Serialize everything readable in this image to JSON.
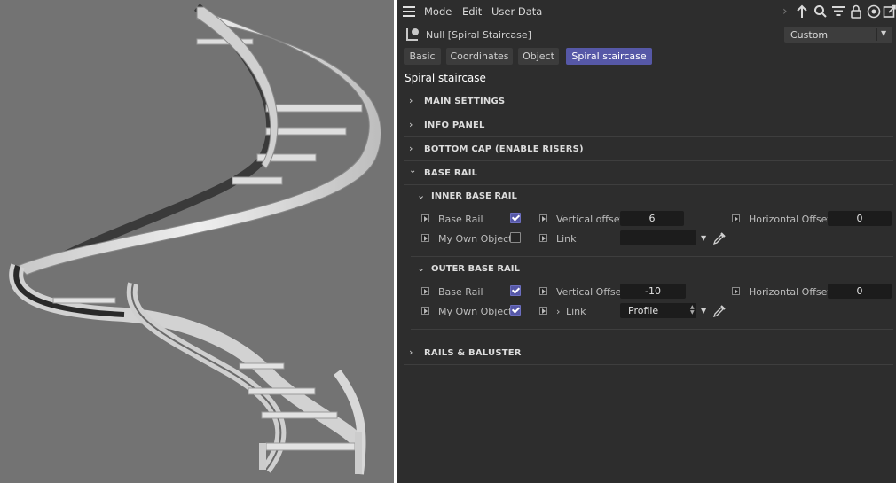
{
  "menu": {
    "items": [
      "Mode",
      "Edit",
      "User Data"
    ]
  },
  "object": {
    "name": "Null [Spiral Staircase]",
    "layout_dropdown": "Custom"
  },
  "tabs": [
    "Basic",
    "Coordinates",
    "Object",
    "Spiral staircase"
  ],
  "active_tab": "Spiral staircase",
  "section_title": "Spiral staircase",
  "groups": {
    "main_settings": "MAIN SETTINGS",
    "info_panel": "INFO PANEL",
    "bottom_cap": "BOTTOM CAP (ENABLE RISERS)",
    "base_rail": "BASE RAIL",
    "rails_baluster": "RAILS & BALUSTER"
  },
  "inner": {
    "title": "INNER BASE RAIL",
    "base_rail_label": "Base Rail",
    "base_rail_checked": true,
    "vertical_offset_label": "Vertical offset",
    "vertical_offset": "6",
    "horizontal_offset_label": "Horizontal Offset",
    "horizontal_offset": "0",
    "my_own_object_label": "My Own Object",
    "my_own_object_checked": false,
    "link_label": "Link",
    "link_value": ""
  },
  "outer": {
    "title": "OUTER BASE RAIL",
    "base_rail_label": "Base Rail",
    "base_rail_checked": true,
    "vertical_offset_label": "Vertical Offset",
    "vertical_offset": "-10",
    "horizontal_offset_label": "Horizontal Offset",
    "horizontal_offset": "0",
    "my_own_object_label": "My Own Object",
    "my_own_object_checked": true,
    "link_label": "Link",
    "link_value": "Profile"
  },
  "icons": {
    "menu": "hamburger-icon",
    "toolbar": [
      "chevron-right-icon",
      "arrow-up-icon",
      "search-icon",
      "filter-icon",
      "lock-icon",
      "target-icon",
      "new-window-icon"
    ],
    "object": "null-object-icon",
    "picker": "eyedropper-icon"
  },
  "colors": {
    "panel_bg": "#2d2d2d",
    "viewport_bg": "#737373",
    "accent": "#5658a7",
    "field_bg": "#1c1c1c"
  }
}
